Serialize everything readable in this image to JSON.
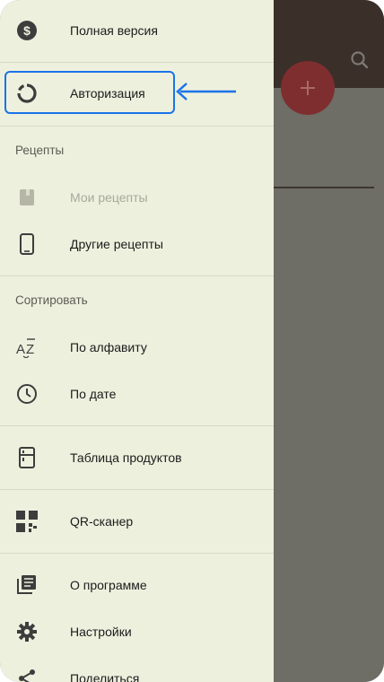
{
  "drawer": {
    "items_top": [
      {
        "id": "full",
        "label": "Полная версия",
        "icon": "dollar-circle-icon"
      },
      {
        "id": "auth",
        "label": "Авторизация",
        "icon": "circle-progress-icon"
      }
    ],
    "recipes_section": {
      "title": "Рецепты",
      "items": [
        {
          "id": "my",
          "label": "Мои рецепты",
          "icon": "book-icon",
          "disabled": true
        },
        {
          "id": "other",
          "label": "Другие рецепты",
          "icon": "phone-icon"
        }
      ]
    },
    "sort_section": {
      "title": "Сортировать",
      "items": [
        {
          "id": "alpha",
          "label": "По алфавиту",
          "icon": "sort-alpha-icon"
        },
        {
          "id": "date",
          "label": "По дате",
          "icon": "clock-icon"
        }
      ]
    },
    "products": {
      "label": "Таблица продуктов",
      "icon": "fridge-icon"
    },
    "qr": {
      "label": "QR-сканер",
      "icon": "qr-icon"
    },
    "bottom_items": [
      {
        "id": "about",
        "label": "О программе",
        "icon": "library-books-icon"
      },
      {
        "id": "settings",
        "label": "Настройки",
        "icon": "gear-icon"
      },
      {
        "id": "share",
        "label": "Поделиться",
        "icon": "share-icon"
      }
    ]
  },
  "colors": {
    "drawer_bg": "#eef0de",
    "highlight": "#1a73e8",
    "app_topbar": "#3a2f29",
    "fab": "#7e2e2f"
  }
}
